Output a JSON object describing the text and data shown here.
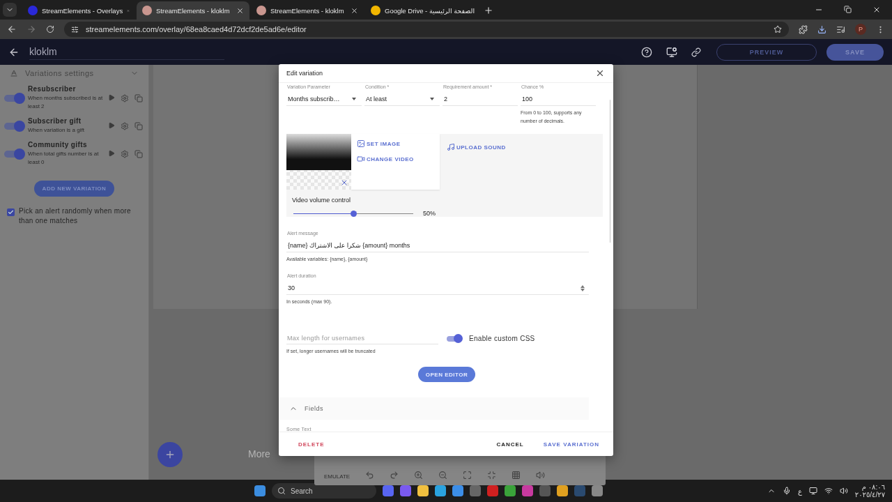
{
  "browser": {
    "tabs": [
      {
        "title": "StreamElements - Overlays",
        "selected": false,
        "kind": "se-blue"
      },
      {
        "title": "StreamElements - kloklm",
        "selected": true,
        "kind": "se"
      },
      {
        "title": "StreamElements - kloklm",
        "selected": false,
        "kind": "se"
      },
      {
        "title": "Google Drive - الصفحة الرئيسية",
        "selected": false,
        "kind": "drive"
      }
    ],
    "url": "streamelements.com/overlay/68ea8caed4d72dcf2de5ad6e/editor",
    "profile": "P"
  },
  "app": {
    "title": "kloklm",
    "preview": "PREVIEW",
    "save": "SAVE"
  },
  "sidebar": {
    "section": "Variations settings",
    "variations": [
      {
        "name": "Resubscriber",
        "description": "When months subscribed is at least 2",
        "enabled": true
      },
      {
        "name": "Subscriber gift",
        "description": "When variation is a gift",
        "enabled": true
      },
      {
        "name": "Community gifts",
        "description": "When total gifts number is at least 0",
        "enabled": true
      }
    ],
    "add_button": "ADD NEW VARIATION",
    "random_pick": {
      "label": "Pick an alert randomly when more than one matches",
      "checked": true
    }
  },
  "canvas": {
    "more": "More",
    "emulate": "EMULATE"
  },
  "dialog": {
    "title": "Edit variation",
    "fields": [
      {
        "label": "Variation Parameter",
        "value": "Months subscrib…",
        "kind": "select"
      },
      {
        "label": "Condition *",
        "value": "At least",
        "kind": "select"
      },
      {
        "label": "Requirement amount *",
        "value": "2",
        "kind": "text"
      },
      {
        "label": "Chance %",
        "value": "100",
        "kind": "text",
        "helper": "From 0 to 100, supports any number of decimals."
      }
    ],
    "media": {
      "buttons": [
        {
          "label": "SET IMAGE",
          "kind": "image"
        },
        {
          "label": "CHANGE VIDEO",
          "kind": "video"
        }
      ],
      "sound_button": "UPLOAD SOUND",
      "volume": {
        "label": "Video volume control",
        "level": 0.5,
        "reading": "50%"
      }
    },
    "alert_message": {
      "label": "Alert message",
      "value": "{name} شكرا على الاشتراك {amount} months",
      "helper": "Available variables: {name}, {amount}"
    },
    "alert_duration": {
      "label": "Alert duration",
      "value": "30",
      "helper": "In seconds (max 90)."
    },
    "max_length": {
      "placeholder": "Max length for usernames",
      "helper": "If set, longer usernames will be truncated"
    },
    "custom_css": {
      "label": "Enable custom CSS",
      "on": true,
      "button": "OPEN EDITOR"
    },
    "fields_section": {
      "title": "Fields",
      "expanded": true,
      "items": [
        {
          "label": "Some Text"
        }
      ]
    },
    "footer": {
      "delete": "DELETE",
      "cancel": "CANCEL",
      "save": "SAVE VARIATION"
    }
  },
  "taskbar": {
    "search_placeholder": "Search",
    "language": "ع",
    "time": "٠٨:٠٦ م",
    "date": "٢٠٢٥/٤/٢٧"
  }
}
